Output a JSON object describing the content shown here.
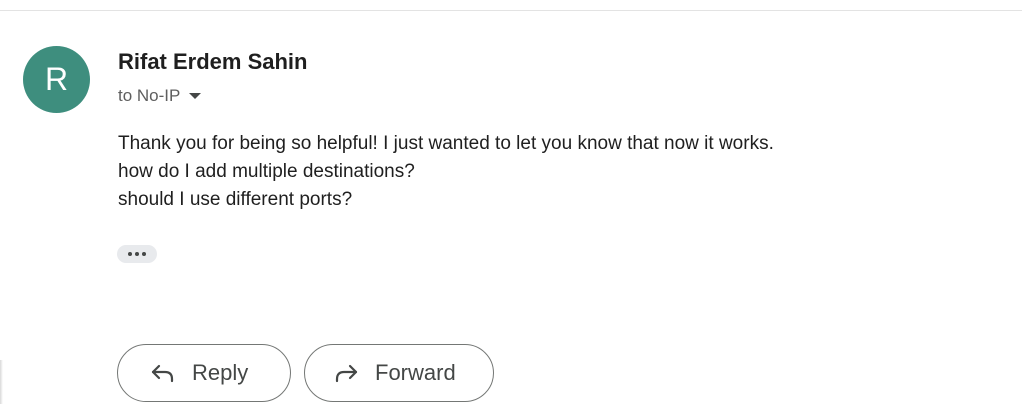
{
  "message": {
    "avatar_initial": "R",
    "sender_name": "Rifat Erdem Sahin",
    "recipient_line": "to No-IP",
    "body_lines": [
      "Thank you for being so helpful! I just wanted to let you know that now it works.",
      "how do I add multiple destinations?",
      "should I use different ports?"
    ],
    "colors": {
      "avatar_bg": "#3e8e7e",
      "button_border": "#747775",
      "button_text": "#444746"
    }
  },
  "actions": {
    "reply_label": "Reply",
    "forward_label": "Forward",
    "reply_icon": "reply-arrow-icon",
    "forward_icon": "forward-arrow-icon",
    "more_icon": "ellipsis-icon"
  }
}
